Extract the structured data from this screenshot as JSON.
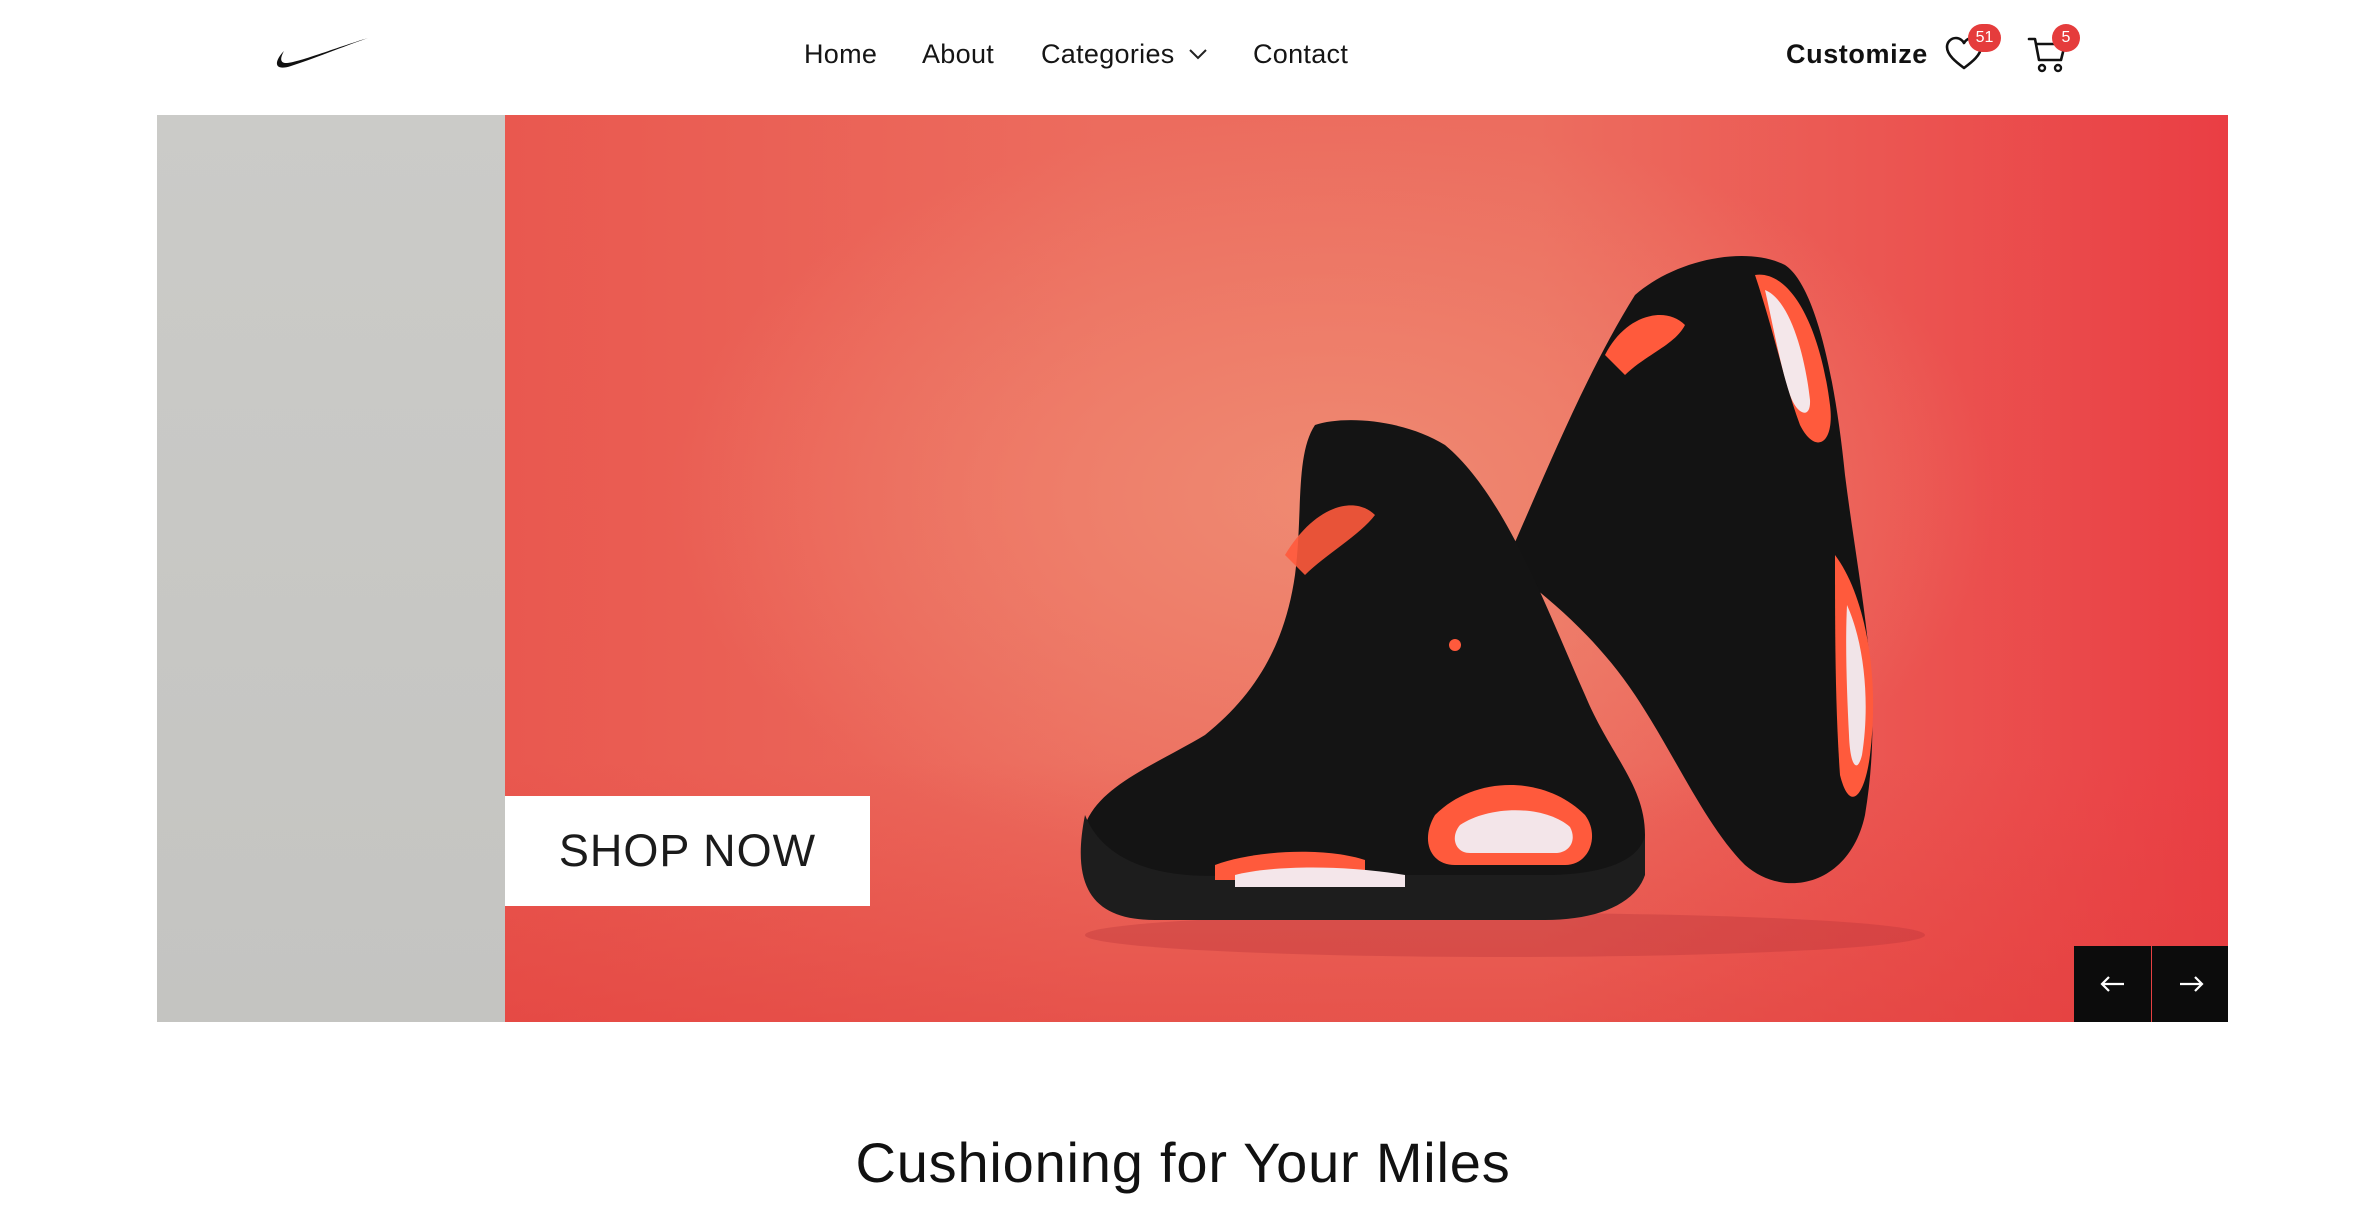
{
  "brand": {
    "logo_icon": "swoosh-logo"
  },
  "nav": {
    "items": [
      {
        "label": "Home"
      },
      {
        "label": "About"
      },
      {
        "label": "Categories",
        "icon": "chevron-down-icon"
      },
      {
        "label": "Contact"
      }
    ]
  },
  "header_actions": {
    "customize_label": "Customize",
    "wishlist": {
      "icon": "heart-icon",
      "count": "51"
    },
    "cart": {
      "icon": "cart-icon",
      "count": "5"
    }
  },
  "hero": {
    "image_subject": "sneakers",
    "cta_label": "SHOP NOW",
    "prev_icon": "arrow-left-icon",
    "next_icon": "arrow-right-icon",
    "colors": {
      "panel": "#c8c8c5",
      "background": "#ec6c5e",
      "accent": "#ff5a3c"
    }
  },
  "section": {
    "title": "Cushioning for Your Miles"
  },
  "colors": {
    "badge": "#e53c3c",
    "text": "#111111"
  }
}
